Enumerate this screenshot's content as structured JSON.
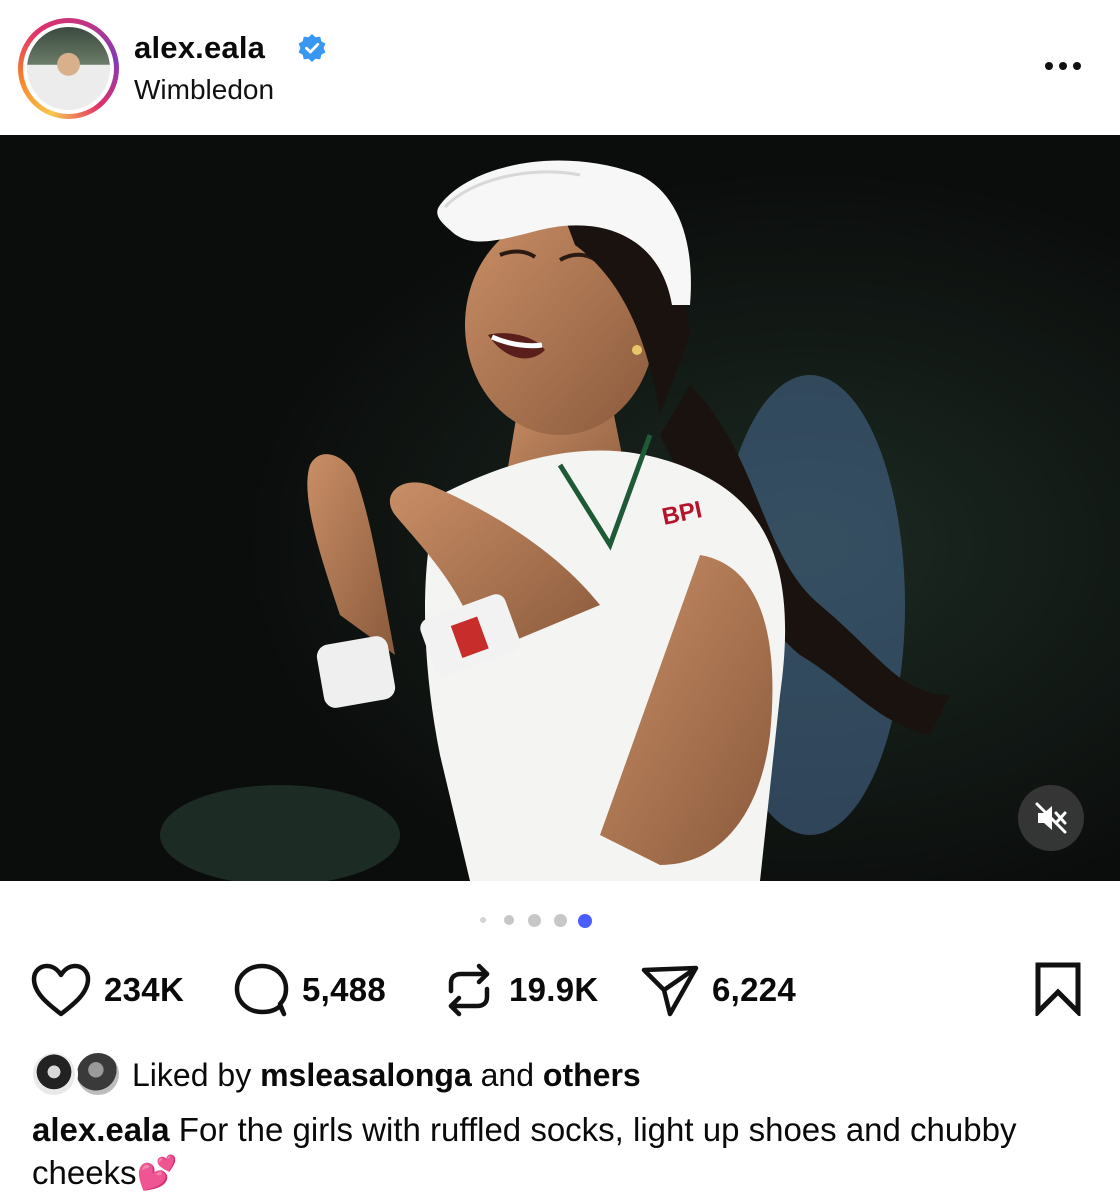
{
  "post": {
    "username": "alex.eala",
    "location": "Wimbledon",
    "verified": true
  },
  "media": {
    "visible_text": [
      "BPI"
    ],
    "carousel": {
      "total_slides": 5,
      "active_index": 4
    }
  },
  "actions": {
    "likes": "234K",
    "comments": "5,488",
    "reposts": "19.9K",
    "shares": "6,224"
  },
  "liked_by": {
    "prefix": "Liked by",
    "user": "msleasalonga",
    "connector": "and",
    "suffix": "others"
  },
  "caption": {
    "username": "alex.eala",
    "text": "For the girls with ruffled socks, light up shoes and chubby cheeks💕"
  },
  "colors": {
    "verified_blue": "#3897f0",
    "active_dot": "#4a5dff",
    "inactive_dot": "#c7c7c7"
  },
  "icons": [
    "verified-badge-icon",
    "more-options-icon",
    "mute-icon",
    "heart-icon",
    "comment-icon",
    "repost-icon",
    "share-icon",
    "bookmark-icon"
  ]
}
